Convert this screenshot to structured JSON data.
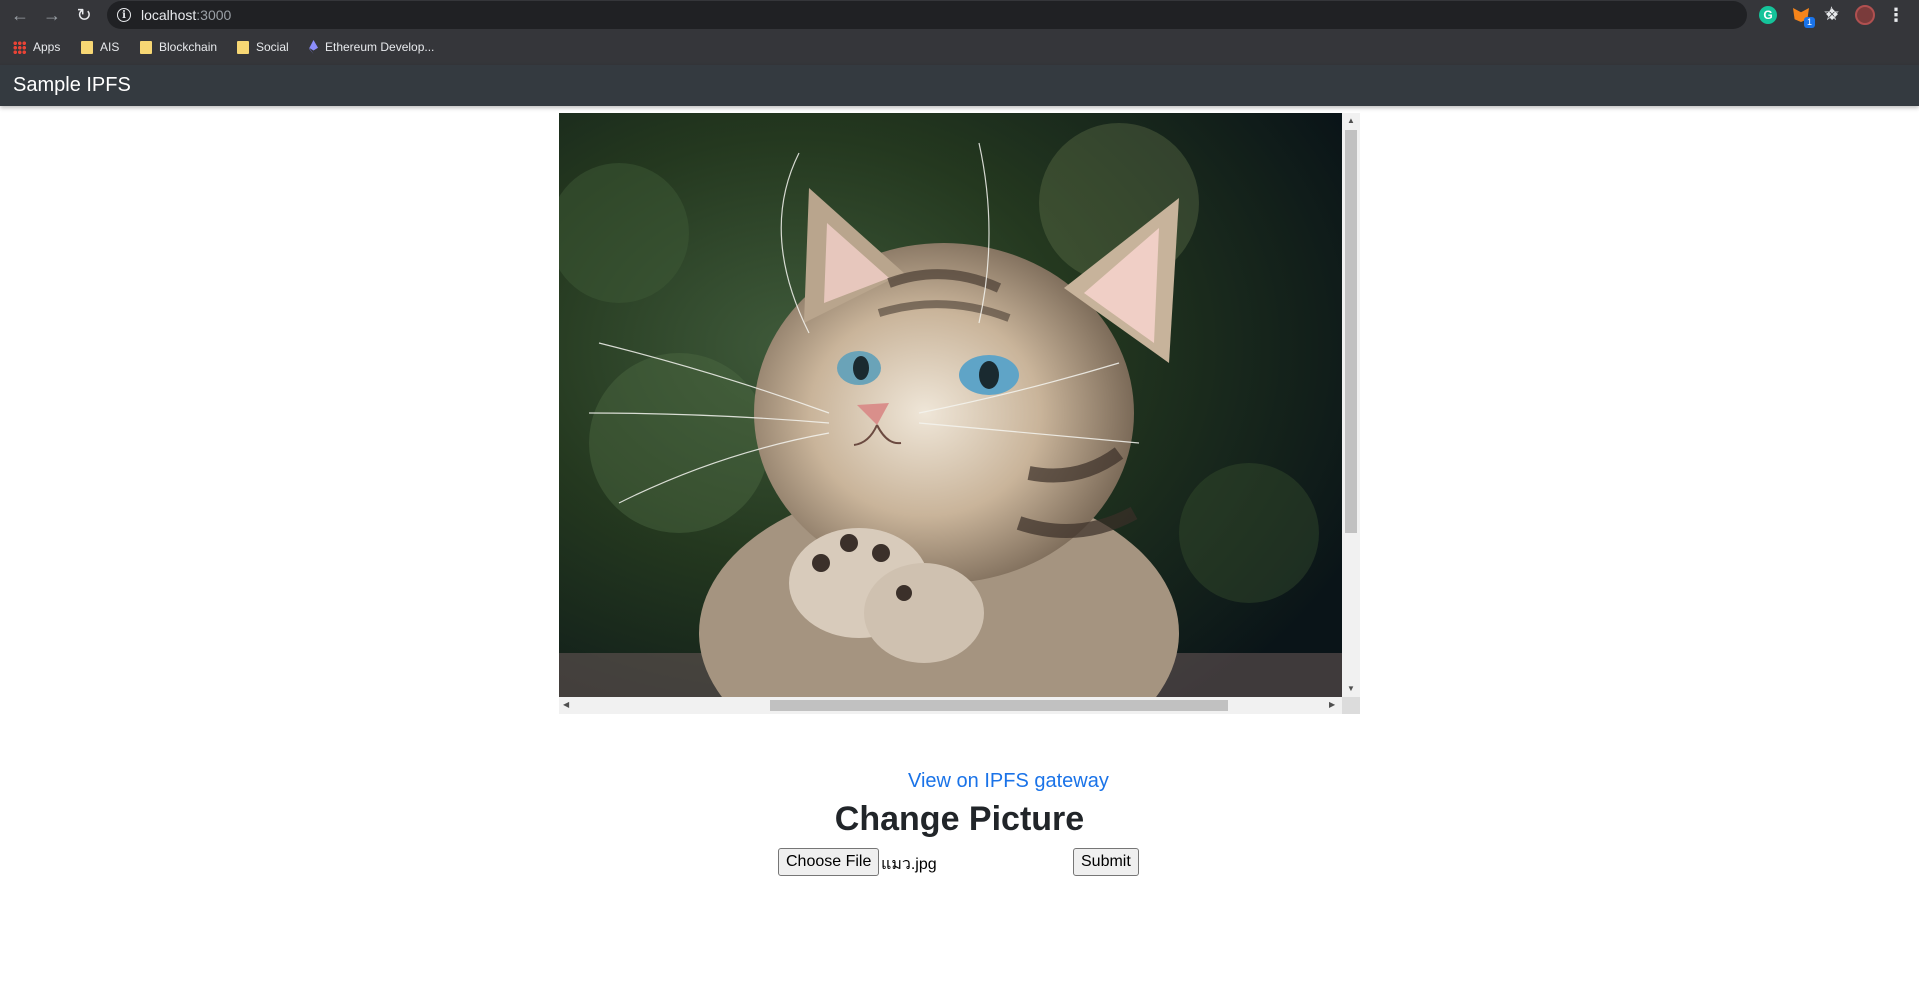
{
  "browser": {
    "url_host": "localhost",
    "url_port": ":3000",
    "bookmarks": [
      {
        "label": "Apps"
      },
      {
        "label": "AIS"
      },
      {
        "label": "Blockchain"
      },
      {
        "label": "Social"
      },
      {
        "label": "Ethereum Develop..."
      }
    ],
    "extension_badge": "1"
  },
  "navbar": {
    "brand": "Sample IPFS",
    "color": "#343a40"
  },
  "viewer": {
    "image_description_icon": "cat-photo"
  },
  "main": {
    "gateway_link": "View on IPFS gateway",
    "title": "Change Picture",
    "choose_file_label": "Choose File",
    "selected_file": "แมว.jpg",
    "submit_label": "Submit"
  },
  "colors": {
    "link": "#1a73e8",
    "heading": "#212529"
  }
}
